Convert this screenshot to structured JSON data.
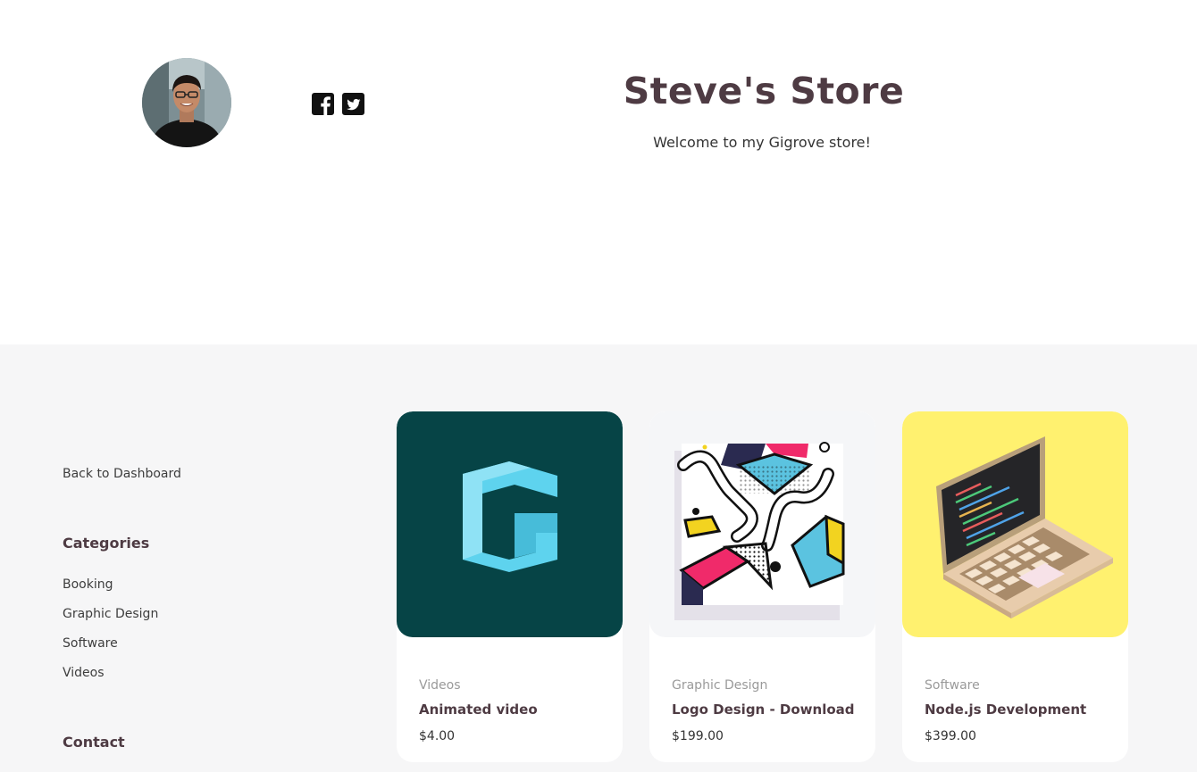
{
  "store": {
    "title": "Steve's Store",
    "welcome": "Welcome to my Gigrove store!"
  },
  "social": {
    "icons": [
      "facebook-icon",
      "twitter-icon"
    ]
  },
  "sidebar": {
    "back_label": "Back to Dashboard",
    "categories_heading": "Categories",
    "categories": [
      "Booking",
      "Graphic Design",
      "Software",
      "Videos"
    ],
    "contact_heading": "Contact"
  },
  "products": [
    {
      "category": "Videos",
      "name": "Animated video",
      "price": "$4.00",
      "thumb_bg": "#064446"
    },
    {
      "category": "Graphic Design",
      "name": "Logo Design - Download",
      "price": "$199.00",
      "thumb_bg": "#f5f6f8"
    },
    {
      "category": "Software",
      "name": "Node.js Development",
      "price": "$399.00",
      "thumb_bg": "#fff16f"
    }
  ],
  "colors": {
    "heading": "#4e3b43",
    "main_bg": "#f6f6f7"
  }
}
